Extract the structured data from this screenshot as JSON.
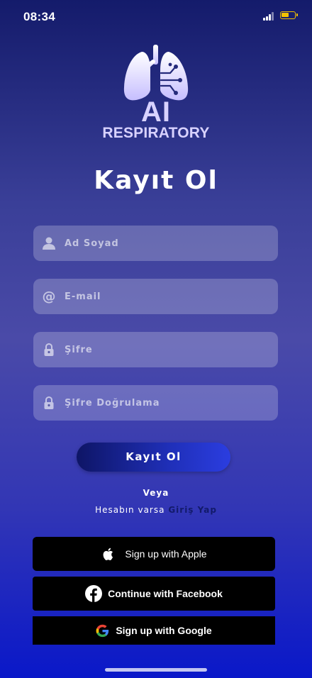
{
  "status_bar": {
    "time": "08:34",
    "battery_level": 0.6,
    "signal_bars": 3
  },
  "brand": {
    "logo_icon": "lungs-circuit-icon",
    "title": "AI",
    "subtitle": "RESPIRATORY"
  },
  "page_title": "Kayıt Ol",
  "form": {
    "name_placeholder": "Ad Soyad",
    "email_placeholder": "E-mail",
    "password_placeholder": "Şifre",
    "confirm_placeholder": "Şifre Doğrulama",
    "submit_label": "Kayıt Ol"
  },
  "alt": {
    "or": "Veya",
    "have_account": "Hesabın varsa",
    "login_link": "Giriş Yap"
  },
  "social": {
    "apple_label": "Sign up with Apple",
    "facebook_label": "Continue with Facebook",
    "google_label": "Sign up with Google"
  },
  "colors": {
    "accent_dark": "#121a6a",
    "battery": "#f2c200",
    "logo": "#d8d2ff"
  }
}
